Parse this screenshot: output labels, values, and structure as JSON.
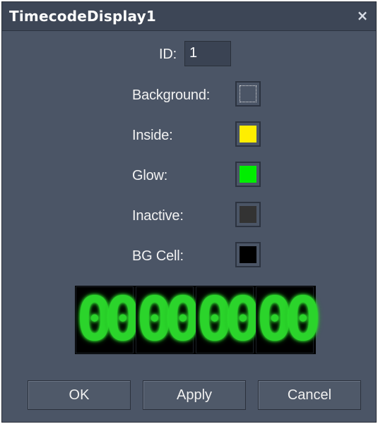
{
  "window": {
    "title": "TimecodeDisplay1",
    "close_icon": "close-icon",
    "close_glyph": "×"
  },
  "id": {
    "label": "ID:",
    "value": "1"
  },
  "colors": [
    {
      "label": "Background:",
      "color": "transparent",
      "key": "background"
    },
    {
      "label": "Inside:",
      "color": "#ffee00",
      "key": "inside"
    },
    {
      "label": "Glow:",
      "color": "#00ee00",
      "key": "glow"
    },
    {
      "label": "Inactive:",
      "color": "#333333",
      "key": "inactive"
    },
    {
      "label": "BG Cell:",
      "color": "#000000",
      "key": "bg-cell"
    }
  ],
  "timecode": {
    "digits": [
      "0",
      "0",
      "0",
      "0",
      "0",
      "0",
      "0",
      "0"
    ],
    "digit_color": "#2bd42b"
  },
  "buttons": {
    "ok": "OK",
    "apply": "Apply",
    "cancel": "Cancel"
  }
}
